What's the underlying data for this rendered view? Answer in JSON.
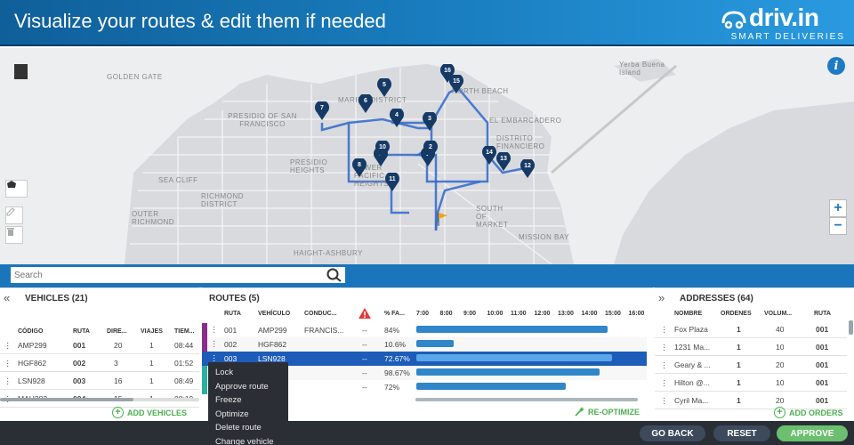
{
  "header": {
    "title": "Visualize your routes & edit them if needed",
    "logo_text": "driv.in",
    "logo_sub": "SMART DELIVERIES"
  },
  "map": {
    "labels": [
      "Golden Gate",
      "PRESIDIO OF SAN FRANCISCO",
      "MARINA DISTRICT",
      "NORTH BEACH",
      "EL EMBARCADERO",
      "DISTRITO FINANCIERO",
      "PRESIDIO HEIGHTS",
      "SEA CLIFF",
      "RICHMOND DISTRICT",
      "OUTER RICHMOND",
      "LOWER PACIFIC HEIGHTS",
      "SOUTH OF MARKET",
      "MISSION BAY",
      "HAIGHT-ASHBURY",
      "Yerba Buena Island"
    ],
    "markers": [
      "1",
      "2",
      "3",
      "4",
      "5",
      "6",
      "7",
      "8",
      "9",
      "10",
      "11",
      "12",
      "13",
      "14",
      "15",
      "16"
    ],
    "zoom_in": "+",
    "zoom_out": "−",
    "info": "i"
  },
  "search": {
    "placeholder": "Search"
  },
  "vehicles": {
    "title": "VEHICLES (21)",
    "columns": [
      "CÓDIGO",
      "RUTA",
      "DIRE...",
      "VIAJES",
      "TIEM..."
    ],
    "rows": [
      [
        "AMP299",
        "001",
        "20",
        "1",
        "08:44"
      ],
      [
        "HGF862",
        "002",
        "3",
        "1",
        "01:52"
      ],
      [
        "LSN928",
        "003",
        "16",
        "1",
        "08:49"
      ],
      [
        "MAH382",
        "004",
        "15",
        "1",
        "08:19"
      ]
    ],
    "add_label": "ADD VEHICLES"
  },
  "routes": {
    "title": "ROUTES (5)",
    "columns": [
      "RUTA",
      "VEHÍCULO",
      "CONDUC...",
      "% FA..."
    ],
    "hours": [
      "7:00",
      "8:00",
      "9:00",
      "10:00",
      "11:00",
      "12:00",
      "13:00",
      "14:00",
      "15:00",
      "16:00"
    ],
    "rows": [
      {
        "ruta": "001",
        "vehiculo": "AMP299",
        "conductor": "FRANCIS...",
        "dash": "--",
        "pct": "84%",
        "color": "#8b2c8f",
        "progress": 0.92
      },
      {
        "ruta": "002",
        "vehiculo": "HGF862",
        "conductor": "",
        "dash": "--",
        "pct": "10.6%",
        "color": "#8b2c8f",
        "progress": 0.18
      },
      {
        "ruta": "003",
        "vehiculo": "LSN928",
        "conductor": "",
        "dash": "--",
        "pct": "72.67%",
        "color": "#1d5cb8",
        "progress": 0.94
      },
      {
        "ruta": "",
        "vehiculo": "",
        "conductor": "",
        "dash": "--",
        "pct": "98.67%",
        "color": "#2ab0a0",
        "progress": 0.88
      },
      {
        "ruta": "",
        "vehiculo": "",
        "conductor": "",
        "dash": "--",
        "pct": "72%",
        "color": "#2ab0a0",
        "progress": 0.72
      }
    ],
    "reoptimize_label": "RE-OPTIMIZE"
  },
  "context_menu": {
    "items": [
      "Lock",
      "Approve route",
      "Freeze",
      "Optimize",
      "Delete route",
      "Change vehicle"
    ]
  },
  "addresses": {
    "title": "ADDRESSES (64)",
    "columns": [
      "NOMBRE",
      "ORDENES",
      "VOLUM...",
      "RUTA"
    ],
    "rows": [
      [
        "Fox Plaza",
        "1",
        "40",
        "001"
      ],
      [
        "1231 Ma...",
        "1",
        "10",
        "001"
      ],
      [
        "Geary & ...",
        "1",
        "20",
        "001"
      ],
      [
        "Hilton @...",
        "1",
        "10",
        "001"
      ],
      [
        "Cyril Ma...",
        "1",
        "20",
        "001"
      ]
    ],
    "add_label": "ADD ORDERS"
  },
  "footer": {
    "go_back": "GO BACK",
    "reset": "RESET",
    "approve": "APPROVE"
  },
  "colors": {
    "primary": "#1a75bb",
    "approve": "#4caf50",
    "route_line": "#3a6ecb",
    "marker": "#163a66"
  }
}
